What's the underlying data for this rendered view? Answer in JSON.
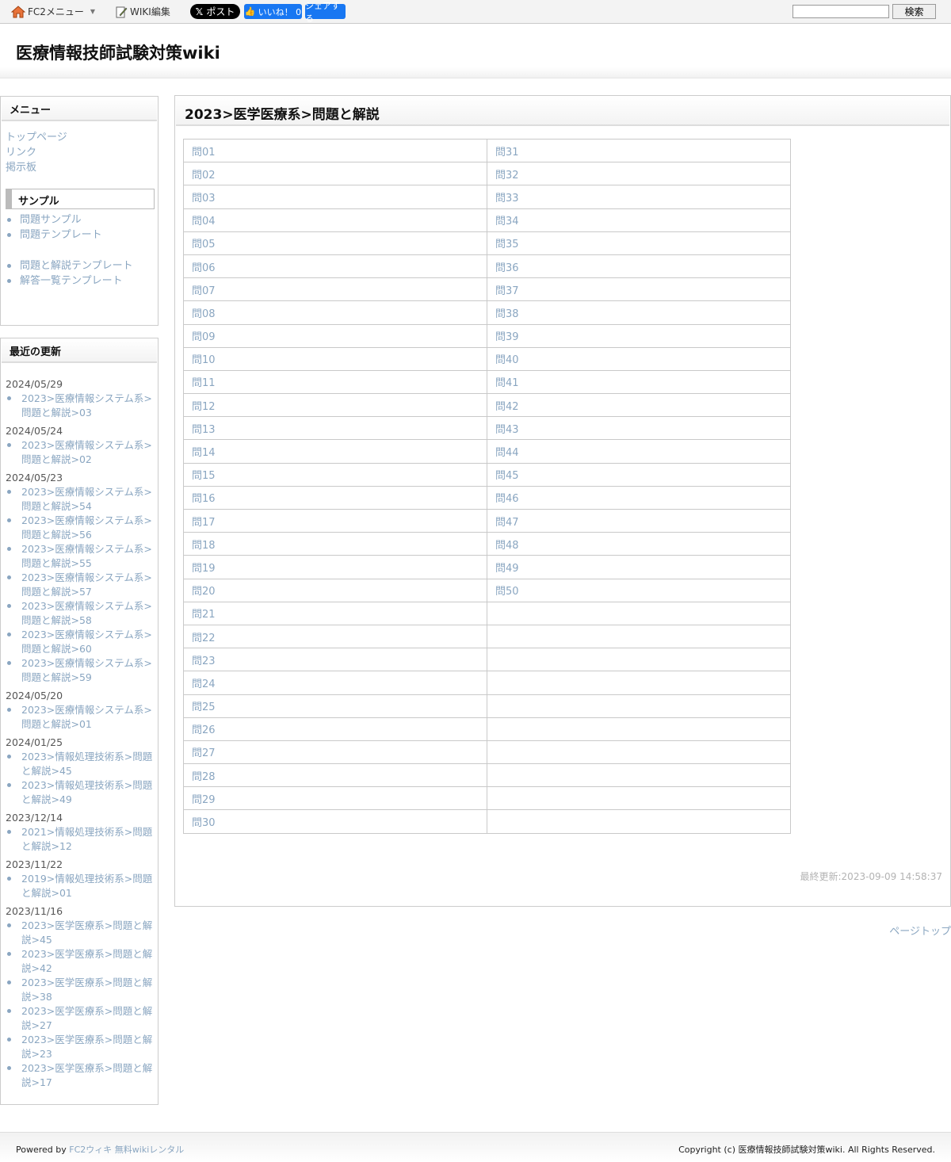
{
  "topbar": {
    "fc2_menu": "FC2メニュー",
    "wiki_edit": "WIKI編集",
    "x_post": "ポスト",
    "fb_like": "いいね！ 0",
    "fb_share": "シェアする",
    "search_button": "検索",
    "search_value": ""
  },
  "header": {
    "site_title": "医療情報技師試験対策wiki"
  },
  "menu": {
    "title": "メニュー",
    "top_links": [
      "トップページ",
      "リンク",
      "掲示板"
    ],
    "sample_title": "サンプル",
    "sample_links_1": [
      "問題サンプル",
      "問題テンプレート"
    ],
    "sample_links_2": [
      "問題と解説テンプレート",
      "解答一覧テンプレート"
    ]
  },
  "recent": {
    "title": "最近の更新",
    "groups": [
      {
        "date": "2024/05/29",
        "items": [
          "2023>医療情報システム系>問題と解説>03"
        ]
      },
      {
        "date": "2024/05/24",
        "items": [
          "2023>医療情報システム系>問題と解説>02"
        ]
      },
      {
        "date": "2024/05/23",
        "items": [
          "2023>医療情報システム系>問題と解説>54",
          "2023>医療情報システム系>問題と解説>56",
          "2023>医療情報システム系>問題と解説>55",
          "2023>医療情報システム系>問題と解説>57",
          "2023>医療情報システム系>問題と解説>58",
          "2023>医療情報システム系>問題と解説>60",
          "2023>医療情報システム系>問題と解説>59"
        ]
      },
      {
        "date": "2024/05/20",
        "items": [
          "2023>医療情報システム系>問題と解説>01"
        ]
      },
      {
        "date": "2024/01/25",
        "items": [
          "2023>情報処理技術系>問題と解説>45",
          "2023>情報処理技術系>問題と解説>49"
        ]
      },
      {
        "date": "2023/12/14",
        "items": [
          "2021>情報処理技術系>問題と解説>12"
        ]
      },
      {
        "date": "2023/11/22",
        "items": [
          "2019>情報処理技術系>問題と解説>01"
        ]
      },
      {
        "date": "2023/11/16",
        "items": [
          "2023>医学医療系>問題と解説>45",
          "2023>医学医療系>問題と解説>42",
          "2023>医学医療系>問題と解説>38",
          "2023>医学医療系>問題と解説>27",
          "2023>医学医療系>問題と解説>23",
          "2023>医学医療系>問題と解説>17"
        ]
      }
    ]
  },
  "main": {
    "page_title": "2023>医学医療系>問題と解説",
    "left_column": [
      "問01",
      "問02",
      "問03",
      "問04",
      "問05",
      "問06",
      "問07",
      "問08",
      "問09",
      "問10",
      "問11",
      "問12",
      "問13",
      "問14",
      "問15",
      "問16",
      "問17",
      "問18",
      "問19",
      "問20",
      "問21",
      "問22",
      "問23",
      "問24",
      "問25",
      "問26",
      "問27",
      "問28",
      "問29",
      "問30"
    ],
    "right_column": [
      "問31",
      "問32",
      "問33",
      "問34",
      "問35",
      "問36",
      "問37",
      "問38",
      "問39",
      "問40",
      "問41",
      "問42",
      "問43",
      "問44",
      "問45",
      "問46",
      "問47",
      "問48",
      "問49",
      "問50",
      "",
      "",
      "",
      "",
      "",
      "",
      "",
      "",
      "",
      ""
    ],
    "last_updated": "最終更新:2023-09-09 14:58:37",
    "page_top": "ページトップ"
  },
  "footer": {
    "powered_by": "Powered by ",
    "powered_link": "FC2ウィキ 無料wikiレンタル",
    "copyright": "Copyright (c) 医療情報技師試験対策wiki. All Rights Reserved."
  }
}
